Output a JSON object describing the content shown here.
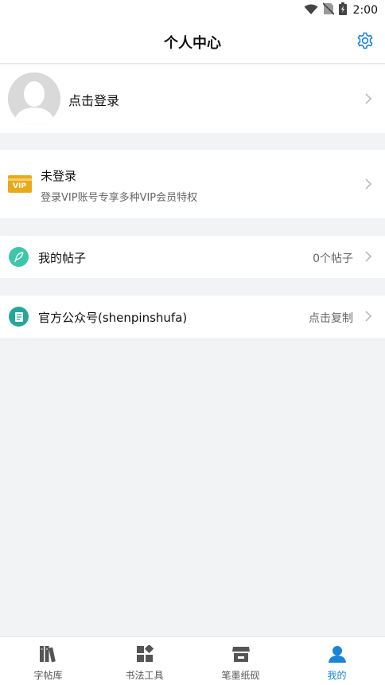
{
  "status_bar": {
    "time": "2:00"
  },
  "header": {
    "title": "个人中心"
  },
  "profile": {
    "login_label": "点击登录"
  },
  "vip": {
    "badge": "VIP",
    "title": "未登录",
    "subtitle": "登录VIP账号专享多种VIP会员特权"
  },
  "rows": [
    {
      "label": "我的帖子",
      "value": "0个帖子"
    },
    {
      "label": "官方公众号(shenpinshufa)",
      "value": "点击复制"
    }
  ],
  "tabbar": {
    "tabs": [
      {
        "label": "字帖库"
      },
      {
        "label": "书法工具"
      },
      {
        "label": "笔墨纸砚"
      },
      {
        "label": "我的"
      }
    ]
  },
  "colors": {
    "accent": "#1a84d6",
    "post_icon": "#3ec6a8",
    "account_icon": "#26a69a",
    "vip_gold": "#e9a91c"
  }
}
